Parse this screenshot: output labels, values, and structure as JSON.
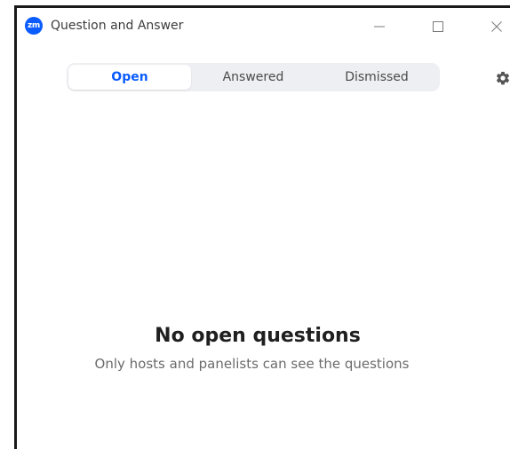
{
  "window": {
    "app_icon_text": "zm",
    "title": "Question and Answer",
    "controls": {
      "minimize": "minimize-icon",
      "maximize": "maximize-icon",
      "close": "close-icon"
    }
  },
  "tabs": [
    {
      "label": "Open",
      "active": true
    },
    {
      "label": "Answered",
      "active": false
    },
    {
      "label": "Dismissed",
      "active": false
    }
  ],
  "settings": {
    "icon": "gear-icon"
  },
  "empty_state": {
    "title": "No open questions",
    "subtitle": "Only hosts and panelists can see the questions"
  },
  "colors": {
    "accent": "#0b5cff",
    "tab_bar_bg": "#eeeff2",
    "title_text": "#1f1f1f",
    "muted_text": "#6b6b6b",
    "frame_border": "#1a1a1a"
  }
}
